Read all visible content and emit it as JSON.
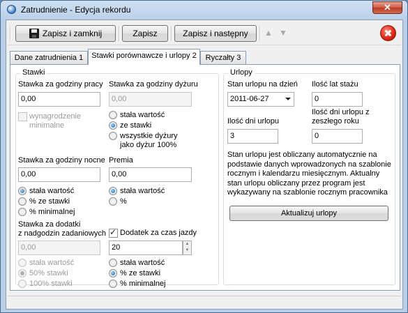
{
  "window": {
    "title": "Zatrudnienie - Edycja rekordu"
  },
  "toolbar": {
    "save_close": "Zapisz i zamknij",
    "save": "Zapisz",
    "save_next": "Zapisz i następny"
  },
  "tabs": [
    "Dane zatrudnienia 1",
    "Stawki porównawcze i urlopy 2",
    "Ryczałty 3"
  ],
  "stawki": {
    "title": "Stawki",
    "hourly_label": "Stawka za godziny pracy",
    "hourly_value": "0,00",
    "extra_pay_label1": "wynagrodzenie",
    "extra_pay_label2": "minimalne",
    "duty_label": "Stawka za godziny dyżuru",
    "duty_value": "0,00",
    "duty_opt1": "stała wartość",
    "duty_opt2": "ze stawki",
    "duty_opt3a": "wszystkie dyżury",
    "duty_opt3b": "jako dyżur 100%",
    "night_label": "Stawka za godziny nocne",
    "night_value": "0,00",
    "night_opt1": "stała wartość",
    "night_opt2": "% ze stawki",
    "night_opt3": "% minimalnej",
    "bonus_label": "Premia",
    "bonus_value": "0,00",
    "bonus_opt1": "stała wartość",
    "bonus_opt2": "%",
    "overtime_label1": "Stawka za dodatki",
    "overtime_label2": "z nadgodzin zadaniowych",
    "overtime_value": "0,00",
    "overtime_opt1": "stała wartość",
    "overtime_opt2": "50% stawki",
    "overtime_opt3": "100% stawki",
    "travel_label": "Dodatek za czas jazdy",
    "travel_value": "20",
    "travel_opt1": "stała wartość",
    "travel_opt2": "% ze stawki",
    "travel_opt3": "% minimalnej"
  },
  "urlopy": {
    "title": "Urlopy",
    "state_label": "Stan urlopu na dzień",
    "state_date": "2011-06-27",
    "seniority_label": "Ilość lat stażu",
    "seniority_value": "0",
    "days_label": "Ilość dni urlopu",
    "days_value": "3",
    "prev_label1": "Ilość dni urlopu z",
    "prev_label2": "zeszłego roku",
    "prev_value": "0",
    "info_lines": [
      "Stan urlopu jest obliczany automatycznie na",
      "podstawie danych wprowadzonych na szablonie",
      "rocznym i kalendarzu miesięcznym. Aktualny",
      "stan urlopu obliczany przez program jest",
      "wykazywany na szablonie rocznym pracownika"
    ],
    "update_button": "Aktualizuj urlopy"
  }
}
